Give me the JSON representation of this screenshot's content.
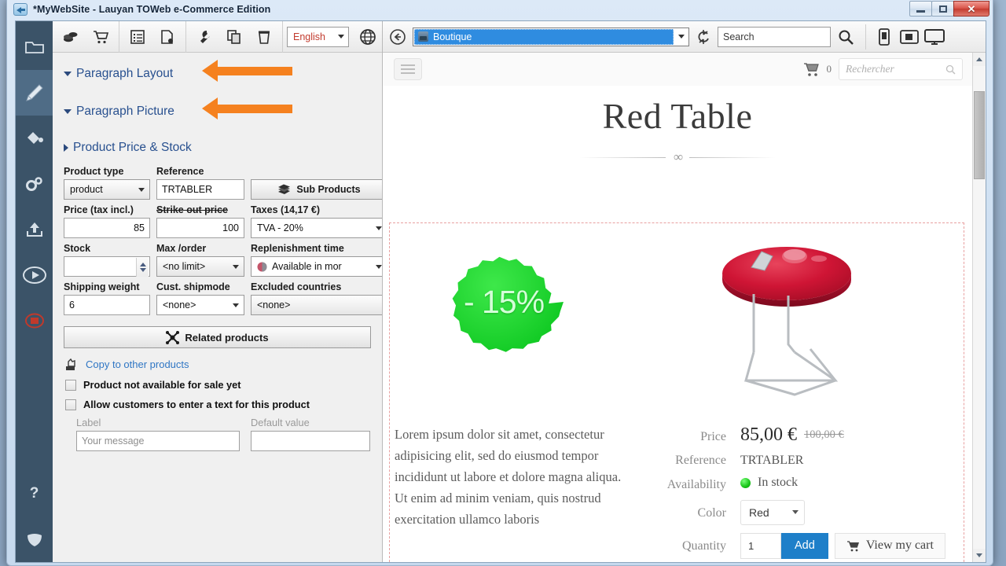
{
  "window": {
    "title": "*MyWebSite - Lauyan TOWeb e-Commerce Edition",
    "minimize_label": "",
    "maximize_label": "",
    "close_label": "✕"
  },
  "rail": {
    "items": [
      {
        "name": "site-icon",
        "label": ""
      },
      {
        "name": "edit-icon",
        "label": ""
      },
      {
        "name": "theme-icon",
        "label": ""
      },
      {
        "name": "settings-icon",
        "label": ""
      },
      {
        "name": "publish-icon",
        "label": ""
      },
      {
        "name": "preview-icon",
        "label": ""
      },
      {
        "name": "stop-icon",
        "label": ""
      },
      {
        "name": "help-icon",
        "label": "?"
      },
      {
        "name": "shield-icon",
        "label": ""
      }
    ]
  },
  "editor_toolbar": {
    "buttons": [
      "coins-icon",
      "cart-icon",
      "list-icon",
      "new-page-icon",
      "wrench-icon",
      "copy-icon",
      "trash-icon"
    ],
    "language": "English",
    "globe_icon": "globe-icon"
  },
  "sections": [
    {
      "title": "Paragraph Layout",
      "expanded": true,
      "annotated": true
    },
    {
      "title": "Paragraph Picture",
      "expanded": true,
      "annotated": true
    },
    {
      "title": "Product Price & Stock",
      "expanded": false,
      "annotated": false
    }
  ],
  "form": {
    "product_type_label": "Product type",
    "product_type_value": "product",
    "reference_label": "Reference",
    "reference_value": "TRTABLER",
    "sub_products_button": "Sub Products",
    "price_label": "Price (tax incl.)",
    "price_value": "85",
    "strike_price_label": "Strike out price",
    "strike_price_value": "100",
    "taxes_label": "Taxes (14,17 €)",
    "taxes_value": "TVA - 20%",
    "stock_label": "Stock",
    "stock_value": "",
    "max_order_label": "Max /order",
    "max_order_value": "<no limit>",
    "replenishment_label": "Replenishment time",
    "replenishment_value": "Available in mor",
    "shipping_weight_label": "Shipping weight",
    "shipping_weight_value": "6",
    "cust_shipmode_label": "Cust. shipmode",
    "cust_shipmode_value": "<none>",
    "excluded_countries_label": "Excluded countries",
    "excluded_countries_value": "<none>",
    "related_products_button": "Related products",
    "copy_link": "Copy to other products",
    "checkbox_not_available": "Product not available for sale yet",
    "checkbox_allow_text": "Allow customers to enter a text for this product",
    "text_label_label": "Label",
    "text_label_value": "Your message",
    "default_value_label": "Default value",
    "default_value_value": ""
  },
  "preview_toolbar": {
    "back_icon": "back-icon",
    "url_value": "Boutique",
    "refresh_icon": "refresh-icon",
    "search_placeholder": "Search",
    "search_icon": "search-icon",
    "device_buttons": [
      "phone-icon",
      "tablet-icon",
      "desktop-icon"
    ]
  },
  "site": {
    "menu_icon": "hamburger-icon",
    "cart_icon": "cart-icon",
    "cart_count": "0",
    "search_placeholder": "Rechercher",
    "search_icon": "search-icon",
    "product_title": "Red Table",
    "ornament": "∞",
    "discount_badge": "- 15%",
    "product_image": "red-table-photo",
    "description": "Lorem ipsum dolor sit amet, consectetur adipisicing elit, sed do eiusmod tempor incididunt ut labore et dolore magna aliqua. Ut enim ad minim veniam, quis nostrud exercitation ullamco laboris",
    "specs": {
      "price_label": "Price",
      "price_value": "85,00 €",
      "price_old": "100,00 €",
      "reference_label": "Reference",
      "reference_value": "TRTABLER",
      "availability_label": "Availability",
      "availability_value": "In stock",
      "color_label": "Color",
      "color_value": "Red",
      "quantity_label": "Quantity",
      "quantity_value": "1",
      "add_button": "Add",
      "view_cart_button": "View my cart"
    }
  },
  "colors": {
    "accent_orange": "#f5811f",
    "link_blue": "#2f76c4",
    "section_blue": "#28508f",
    "badge_green": "#22d532",
    "add_button_blue": "#1e7fc9",
    "rail_bg": "#3b5368",
    "table_red": "#c8102e"
  }
}
